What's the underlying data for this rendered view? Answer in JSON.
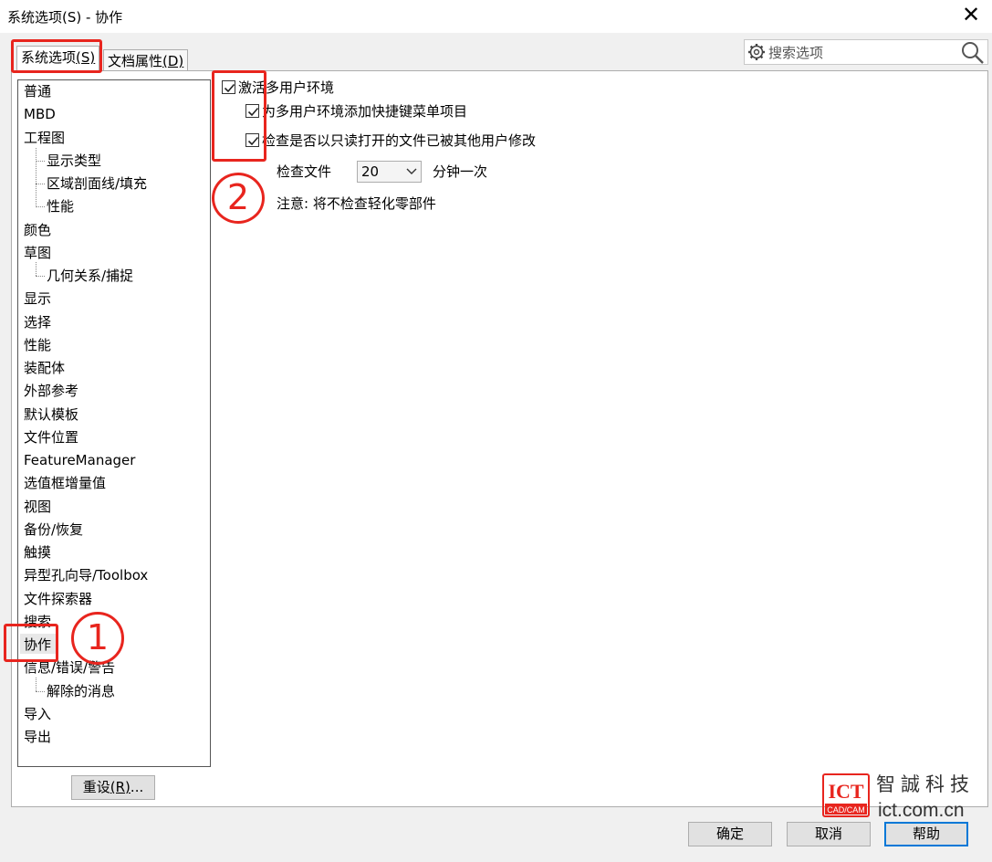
{
  "window": {
    "title": "系统选项(S) - 协作",
    "close_glyph": "✕"
  },
  "tabs": {
    "system": {
      "label": "系统选项",
      "shortcut": "(S)"
    },
    "document": {
      "label": "文档属性",
      "shortcut": "(D)"
    }
  },
  "search": {
    "placeholder": "搜索选项",
    "icons": [
      "gear-icon",
      "magnifier-icon"
    ]
  },
  "tree": {
    "items": [
      {
        "label": "普通",
        "level": 0
      },
      {
        "label": "MBD",
        "level": 0
      },
      {
        "label": "工程图",
        "level": 0
      },
      {
        "label": "显示类型",
        "level": 1
      },
      {
        "label": "区域剖面线/填充",
        "level": 1
      },
      {
        "label": "性能",
        "level": 1
      },
      {
        "label": "颜色",
        "level": 0
      },
      {
        "label": "草图",
        "level": 0
      },
      {
        "label": "几何关系/捕捉",
        "level": 1
      },
      {
        "label": "显示",
        "level": 0
      },
      {
        "label": "选择",
        "level": 0
      },
      {
        "label": "性能",
        "level": 0
      },
      {
        "label": "装配体",
        "level": 0
      },
      {
        "label": "外部参考",
        "level": 0
      },
      {
        "label": "默认模板",
        "level": 0
      },
      {
        "label": "文件位置",
        "level": 0
      },
      {
        "label": "FeatureManager",
        "level": 0
      },
      {
        "label": "选值框增量值",
        "level": 0
      },
      {
        "label": "视图",
        "level": 0
      },
      {
        "label": "备份/恢复",
        "level": 0
      },
      {
        "label": "触摸",
        "level": 0
      },
      {
        "label": "异型孔向导/Toolbox",
        "level": 0
      },
      {
        "label": "文件探索器",
        "level": 0
      },
      {
        "label": "搜索",
        "level": 0
      },
      {
        "label": "协作",
        "level": 0,
        "selected": true
      },
      {
        "label": "信息/错误/警告",
        "level": 0
      },
      {
        "label": "解除的消息",
        "level": 1
      },
      {
        "label": "导入",
        "level": 0
      },
      {
        "label": "导出",
        "level": 0
      }
    ]
  },
  "reset_button": {
    "label": "重设",
    "shortcut": "(R)",
    "suffix": "..."
  },
  "options": {
    "enable_multiuser": {
      "label": "激活多用户环境",
      "checked": true
    },
    "add_shortcut_menu": {
      "label": "为多用户环境添加快捷键菜单项目",
      "checked": true
    },
    "check_readonly_modified": {
      "label": "检查是否以只读打开的文件已被其他用户修改",
      "checked": true
    },
    "check_file_label": "检查文件",
    "interval_value": "20",
    "interval_unit": "分钟一次",
    "note": "注意: 将不检查轻化零部件"
  },
  "annotations": {
    "marker1": "1",
    "marker2": "2"
  },
  "footer": {
    "ok": "确定",
    "cancel": "取消",
    "help": "帮助"
  },
  "watermark": {
    "brand": "ICT",
    "sub": "CAD/CAM",
    "name": "智誠科技",
    "url": "ict.com.cn"
  },
  "colors": {
    "annotation_red": "#e8251e",
    "focus_blue": "#0078d7"
  }
}
